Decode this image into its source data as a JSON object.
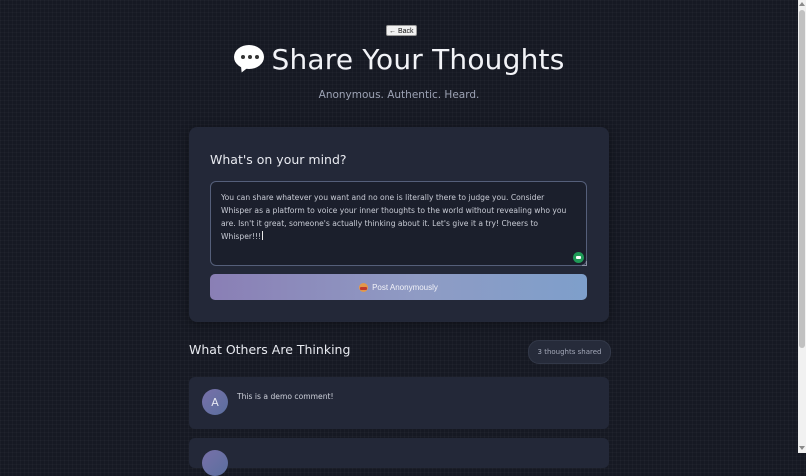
{
  "header": {
    "back_label": "← Back",
    "title": "Share Your Thoughts",
    "title_icon": "speech-bubble-icon",
    "tagline": "Anonymous. Authentic. Heard."
  },
  "composer": {
    "heading": "What's on your mind?",
    "text": "You can share whatever you want and no one is literally there to judge you. Consider Whisper as a platform to voice your inner thoughts to the world without revealing who you are. Isn't it great, someone's actually thinking about it. Let's give it a try! Cheers to Whisper!!!",
    "emoji_icon": "emoji-picker-icon",
    "post_label": "Post Anonymously",
    "post_icon": "mask-icon"
  },
  "feed": {
    "heading": "What Others Are Thinking",
    "count_label": "3 thoughts shared",
    "comments": [
      {
        "avatar_letter": "A",
        "text": "This is a demo comment!"
      }
    ]
  },
  "colors": {
    "background": "#161923",
    "card": "#232838",
    "accent_start": "#8a7fb5",
    "accent_end": "#7e9fcb"
  }
}
